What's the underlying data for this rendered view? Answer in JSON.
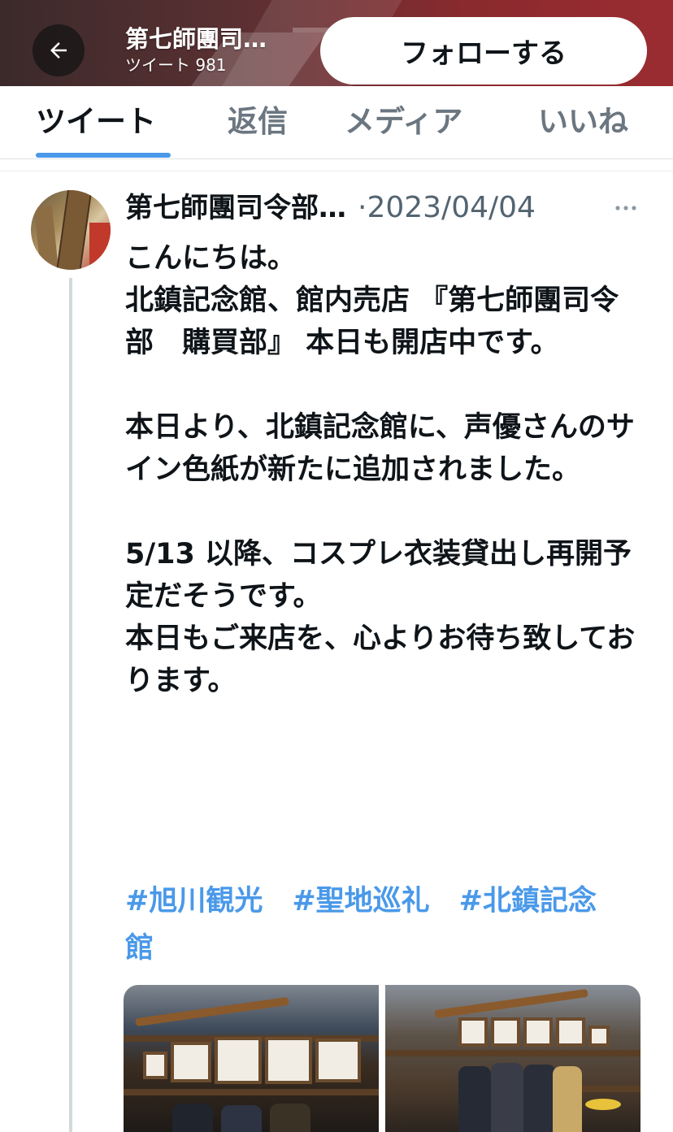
{
  "header": {
    "account_name": "第七師團司令部",
    "tweet_count_label": "ツイート 981",
    "follow_label": "フォローする",
    "back_icon": "arrow-left-icon"
  },
  "tabs": [
    {
      "label": "ツイート",
      "active": true
    },
    {
      "label": "返信",
      "active": false
    },
    {
      "label": "メディア",
      "active": false
    },
    {
      "label": "いいね",
      "active": false
    }
  ],
  "tweet": {
    "author_name": "第七師團司令部　購買部",
    "date": "·2023/04/04",
    "more_icon": "more-dots-icon",
    "body": "こんにちは。\n北鎮記念館、館内売店 『第七師團司令部　購買部』 本日も開店中です。\n\n本日より、北鎮記念館に、声優さんのサイン色紙が新たに追加されました。\n\n5/13 以降、コスプレ衣装貸出し再開予定だそうです。\n本日もご来店を、心よりお待ち致しております。",
    "hashtags": [
      "#旭川観光",
      "#聖地巡礼",
      "#北鎮記念館"
    ]
  },
  "colors": {
    "accent": "#4a99e9",
    "text_primary": "#0f1419",
    "text_secondary": "#536471",
    "banner": "#8a2a2e"
  }
}
